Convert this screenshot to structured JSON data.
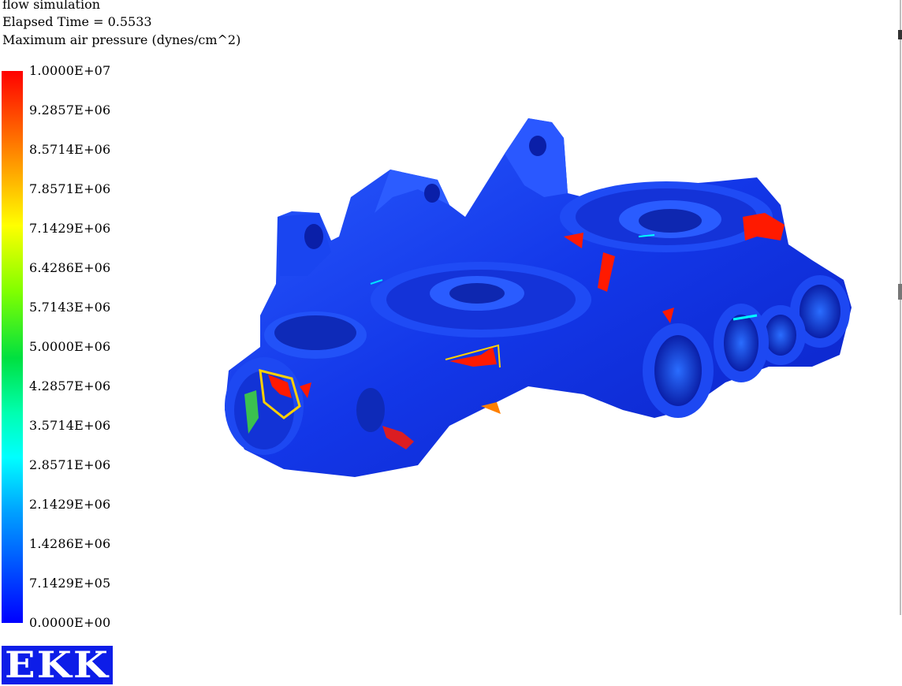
{
  "header": {
    "title": "flow simulation",
    "elapsed_time": "Elapsed Time = 0.5533",
    "variable": "Maximum air pressure (dynes/cm^2)"
  },
  "legend": {
    "tick_labels": [
      "1.0000E+07",
      "9.2857E+06",
      "8.5714E+06",
      "7.8571E+06",
      "7.1429E+06",
      "6.4286E+06",
      "5.7143E+06",
      "5.0000E+06",
      "4.2857E+06",
      "3.5714E+06",
      "2.8571E+06",
      "2.1429E+06",
      "1.4286E+06",
      "7.1429E+05",
      "0.0000E+00"
    ],
    "colors": [
      "#ff0000",
      "#ff8000",
      "#ffff00",
      "#80ff00",
      "#00e040",
      "#00ffff",
      "#00a0ff",
      "#0050ff",
      "#0000ff"
    ]
  },
  "logo": {
    "text": "EKK"
  }
}
